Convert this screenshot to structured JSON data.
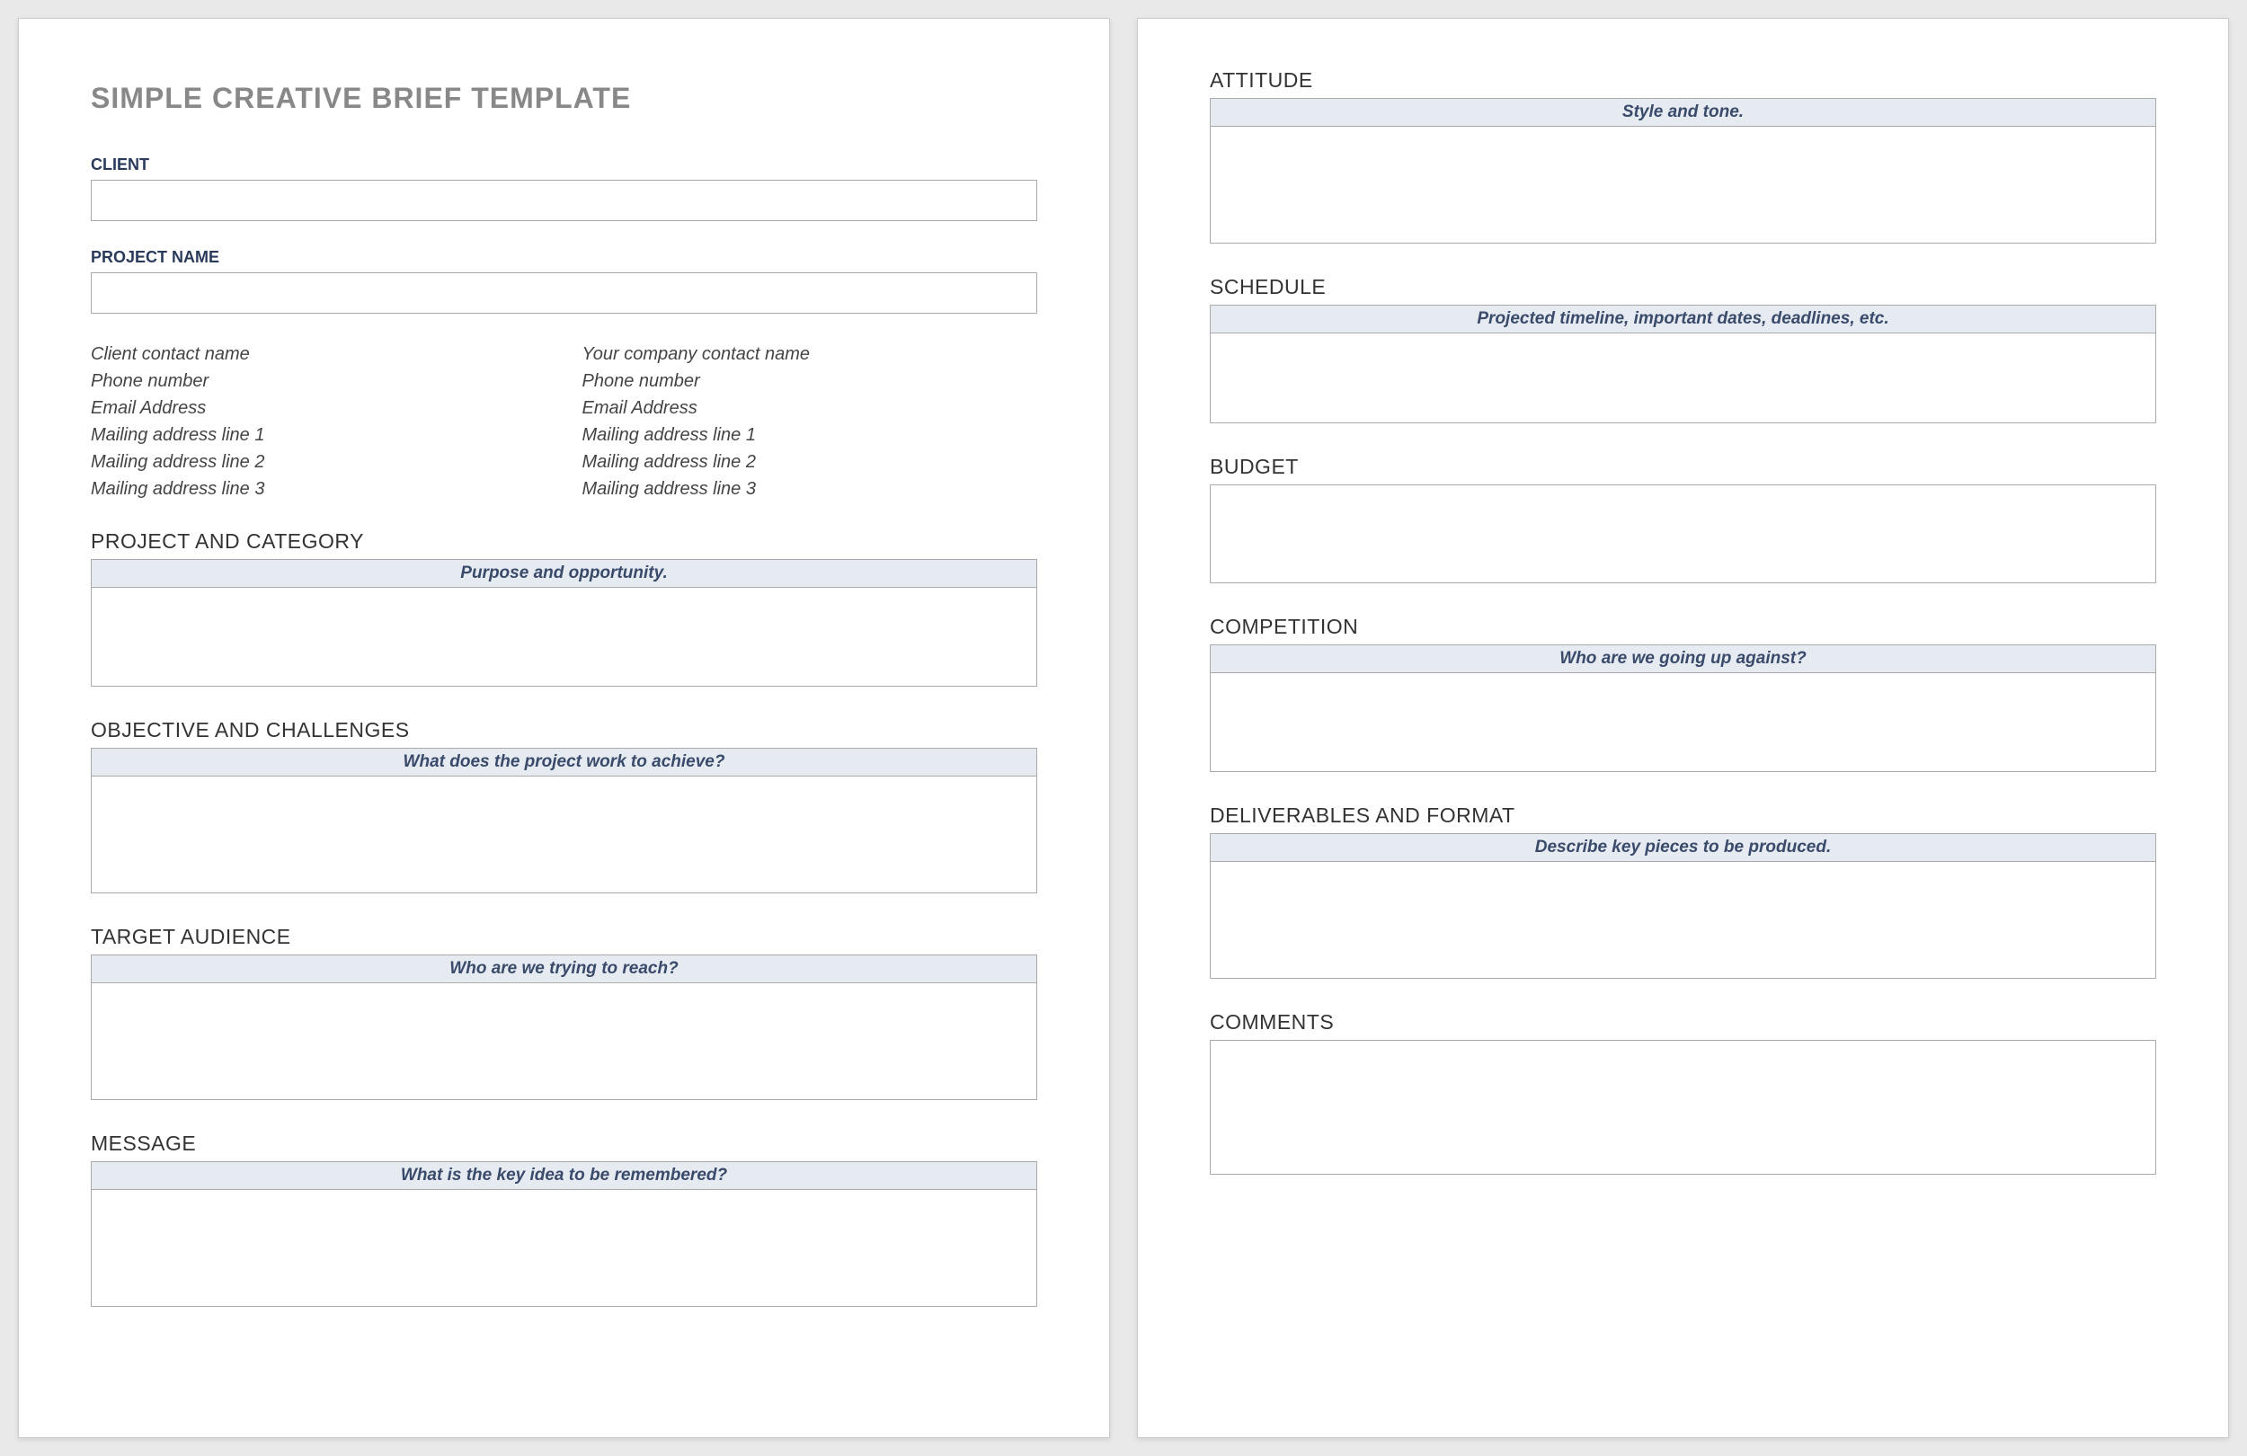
{
  "title": "SIMPLE CREATIVE BRIEF TEMPLATE",
  "labels": {
    "client": "CLIENT",
    "project_name": "PROJECT NAME"
  },
  "contacts": {
    "client": [
      "Client contact name",
      "Phone number",
      "Email Address",
      "Mailing address line 1",
      "Mailing address line 2",
      "Mailing address line 3"
    ],
    "company": [
      "Your company contact name",
      "Phone number",
      "Email Address",
      "Mailing address line 1",
      "Mailing address line 2",
      "Mailing address line 3"
    ]
  },
  "sections": {
    "project_category": {
      "heading": "PROJECT AND CATEGORY",
      "hint": "Purpose and opportunity."
    },
    "objective_challenges": {
      "heading": "OBJECTIVE AND CHALLENGES",
      "hint": "What does the project work to achieve?"
    },
    "target_audience": {
      "heading": "TARGET AUDIENCE",
      "hint": "Who are we trying to reach?"
    },
    "message": {
      "heading": "MESSAGE",
      "hint": "What is the key idea to be remembered?"
    },
    "attitude": {
      "heading": "ATTITUDE",
      "hint": "Style and tone."
    },
    "schedule": {
      "heading": "SCHEDULE",
      "hint": "Projected timeline, important dates, deadlines, etc."
    },
    "budget": {
      "heading": "BUDGET"
    },
    "competition": {
      "heading": "COMPETITION",
      "hint": "Who are we going up against?"
    },
    "deliverables": {
      "heading": "DELIVERABLES AND FORMAT",
      "hint": "Describe key pieces to be produced."
    },
    "comments": {
      "heading": "COMMENTS"
    }
  }
}
